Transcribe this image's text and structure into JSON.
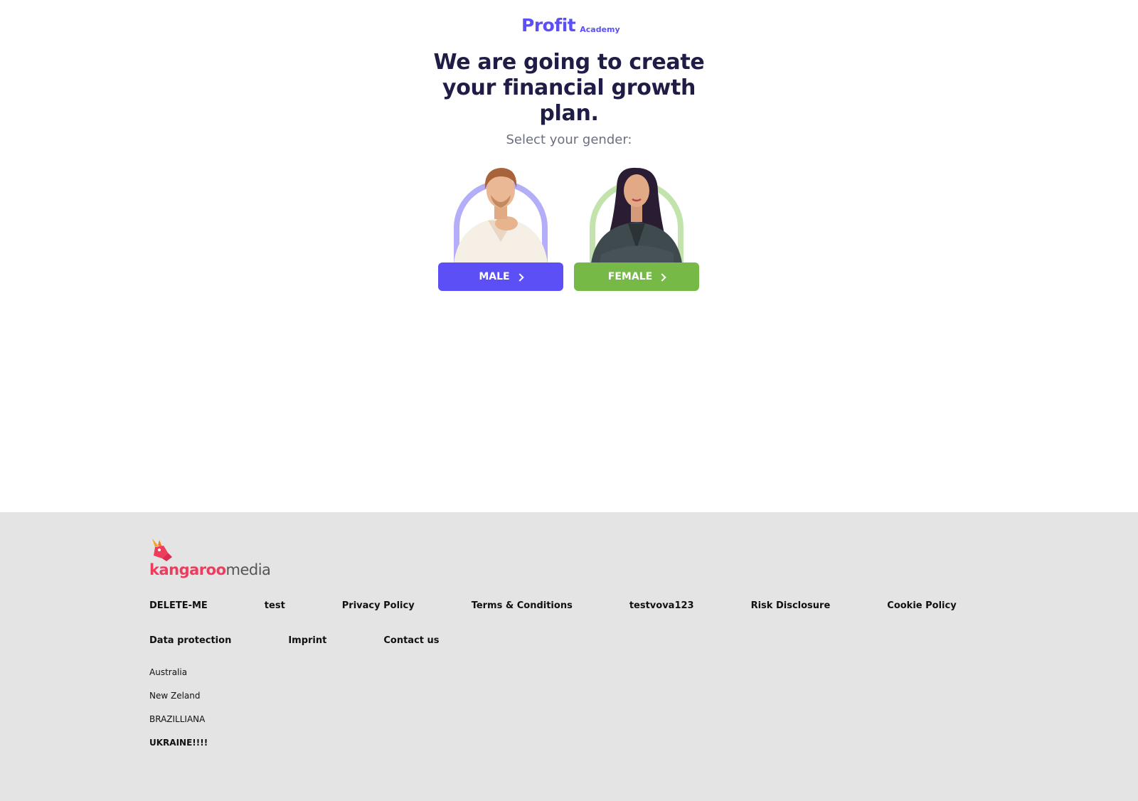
{
  "brand": {
    "name": "Profit",
    "sub": "Academy",
    "color": "#5b4ff5"
  },
  "headline": "We are going to create your financial growth plan.",
  "subtitle": "Select your gender:",
  "options": [
    {
      "label": "MALE",
      "color": "#5b4ff5",
      "arch_color": "#b4aef9"
    },
    {
      "label": "FEMALE",
      "color": "#76b947",
      "arch_color": "#c3e3ad"
    }
  ],
  "footer": {
    "logo": {
      "part1": "kangaroo",
      "part2": "media"
    },
    "links_row1": [
      "DELETE-ME",
      "test",
      "Privacy Policy",
      "Terms & Conditions",
      "testvova123",
      "Risk Disclosure",
      "Cookie Policy"
    ],
    "links_row2": [
      "Data protection",
      "Imprint",
      "Contact us"
    ],
    "countries": [
      "Australia",
      "New Zeland",
      "BRAZILLIANA",
      "UKRAINE!!!!"
    ]
  }
}
